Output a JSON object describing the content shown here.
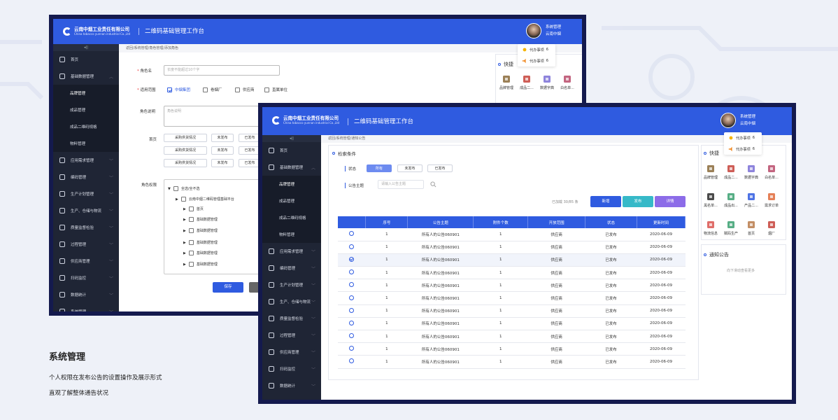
{
  "company": {
    "name_cn": "云南中烟工业责任有限公司",
    "name_en": "China tobacco yunnan industrial Co.,Ltd"
  },
  "app_title": "二维码基础管理工作台",
  "user": {
    "role": "系统管理",
    "org": "云南中烟"
  },
  "todo": [
    {
      "label": "代办事项",
      "count": "6"
    },
    {
      "label": "代办事项",
      "count": "6"
    }
  ],
  "sidebar_toggle": "◂||",
  "w1": {
    "breadcrumb": "返回/系统管理/角色管理/添加角色",
    "menu": [
      {
        "label": "首页",
        "type": "top"
      },
      {
        "label": "基础数据管理",
        "type": "top",
        "arrow": "︿"
      },
      {
        "label": "品牌管理",
        "type": "sub",
        "active": true
      },
      {
        "label": "成品管理",
        "type": "sub"
      },
      {
        "label": "成品二维码规格",
        "type": "sub"
      },
      {
        "label": "物料管理",
        "type": "sub"
      },
      {
        "label": "应用需求管理",
        "type": "top",
        "arrow": "﹀"
      },
      {
        "label": "编码管理",
        "type": "top",
        "arrow": "﹀"
      },
      {
        "label": "生产计划管理",
        "type": "top",
        "arrow": "﹀"
      },
      {
        "label": "生产、仓储与物流",
        "type": "top",
        "arrow": "﹀"
      },
      {
        "label": "质量监督检验",
        "type": "top",
        "arrow": "﹀"
      },
      {
        "label": "过程管理",
        "type": "top",
        "arrow": "﹀"
      },
      {
        "label": "供应商管理",
        "type": "top",
        "arrow": "﹀"
      },
      {
        "label": "扫码监控",
        "type": "top",
        "arrow": "﹀"
      },
      {
        "label": "数据统计",
        "type": "top",
        "arrow": "﹀"
      },
      {
        "label": "系统管理",
        "type": "top",
        "arrow": "﹀"
      }
    ],
    "form": {
      "role_name_label": "角色名",
      "role_name_placeholder": "长度不能超过10个字",
      "scope_label": "适用范围",
      "scope_options": [
        "中烟集团",
        "卷烟厂",
        "供应商",
        "直属单位"
      ],
      "desc_label": "角色说明",
      "desc_placeholder": "角色说明",
      "home_label": "首页",
      "home_rows": [
        [
          "采购供货情况",
          "未发布",
          "已发布"
        ],
        [
          "采购供货情况",
          "未发布",
          "已发布"
        ],
        [
          "采购供货情况",
          "未发布",
          "已发布"
        ]
      ],
      "perm_label": "角色权限",
      "tree": [
        "全选/全不选",
        "云南中烟二维码管理基础平台",
        "首页",
        "基础数据管理",
        "基础数据管理",
        "基础数据管理",
        "基础数据管理",
        "基础数据管理"
      ],
      "save": "保存"
    },
    "quick": {
      "title": "快捷",
      "items": [
        "品牌管理",
        "成品二...",
        "数据字典",
        "白名单..."
      ]
    }
  },
  "w2": {
    "breadcrumb": "返回/系统管理/通知公告",
    "menu": [
      {
        "label": "首页",
        "type": "top"
      },
      {
        "label": "基础数据管理",
        "type": "top",
        "arrow": "︿"
      },
      {
        "label": "品牌管理",
        "type": "sub",
        "active": true
      },
      {
        "label": "成品管理",
        "type": "sub"
      },
      {
        "label": "成品二维码规格",
        "type": "sub"
      },
      {
        "label": "物料管理",
        "type": "sub"
      },
      {
        "label": "应用需求管理",
        "type": "top",
        "arrow": "﹀"
      },
      {
        "label": "编码管理",
        "type": "top",
        "arrow": "﹀"
      },
      {
        "label": "生产计划管理",
        "type": "top",
        "arrow": "﹀"
      },
      {
        "label": "生产、仓储与物流",
        "type": "top",
        "arrow": "﹀"
      },
      {
        "label": "质量监督检验",
        "type": "top",
        "arrow": "﹀"
      },
      {
        "label": "过程管理",
        "type": "top",
        "arrow": "﹀"
      },
      {
        "label": "供应商管理",
        "type": "top",
        "arrow": "﹀"
      },
      {
        "label": "扫码监控",
        "type": "top",
        "arrow": "﹀"
      },
      {
        "label": "数据统计",
        "type": "top",
        "arrow": "﹀"
      },
      {
        "label": "系统管理",
        "type": "top",
        "arrow": "﹀"
      }
    ],
    "search_title": "检索条件",
    "status_label": "状态",
    "status_tabs": [
      "所有",
      "未发布",
      "已发布"
    ],
    "subject_label": "公告主题",
    "subject_placeholder": "请输入公告主题",
    "loaded": "已加载 30/85 条",
    "actions": {
      "add": "新增",
      "publish": "发布",
      "detail": "详情"
    },
    "columns": [
      "",
      "序号",
      "公告主题",
      "附件个数",
      "开放范围",
      "状态",
      "更新时间"
    ],
    "rows": [
      [
        "1",
        "所有人的公告060901",
        "1",
        "供应商",
        "已发布",
        "2020-06-09"
      ],
      [
        "1",
        "所有人的公告060901",
        "1",
        "供应商",
        "已发布",
        "2020-06-09"
      ],
      [
        "1",
        "所有人的公告060901",
        "1",
        "供应商",
        "已发布",
        "2020-06-09"
      ],
      [
        "1",
        "所有人的公告060901",
        "1",
        "供应商",
        "已发布",
        "2020-06-09"
      ],
      [
        "1",
        "所有人的公告060901",
        "1",
        "供应商",
        "已发布",
        "2020-06-09"
      ],
      [
        "1",
        "所有人的公告060901",
        "1",
        "供应商",
        "已发布",
        "2020-06-09"
      ],
      [
        "1",
        "所有人的公告060901",
        "1",
        "供应商",
        "已发布",
        "2020-06-09"
      ],
      [
        "1",
        "所有人的公告060901",
        "1",
        "供应商",
        "已发布",
        "2020-06-09"
      ],
      [
        "1",
        "所有人的公告060901",
        "1",
        "供应商",
        "已发布",
        "2020-06-09"
      ],
      [
        "1",
        "所有人的公告060901",
        "1",
        "供应商",
        "已发布",
        "2020-06-09"
      ],
      [
        "1",
        "所有人的公告060901",
        "1",
        "供应商",
        "已发布",
        "2020-06-09"
      ]
    ],
    "selected_row": 2,
    "quick": {
      "title": "快捷",
      "items": [
        "品牌管理",
        "成品二...",
        "数据字典",
        "白名单...",
        "黑名单...",
        "成品出...",
        "产品二...",
        "需求订单",
        "物流信息",
        "赋码生产",
        "首页",
        "烟厂"
      ]
    },
    "notice": {
      "title": "通知公告",
      "more": "向下滑动查看更多"
    }
  },
  "caption": {
    "title": "系统管理",
    "line1": "个人权限在发布公告的设置操作及展示形式",
    "line2": "直观了解整体通告状况"
  },
  "colors": {
    "primary": "#2f5be0",
    "frame": "#141a4e",
    "sidebar": "#1f2535",
    "teal": "#36b9c8",
    "purple": "#8c6ce8"
  }
}
